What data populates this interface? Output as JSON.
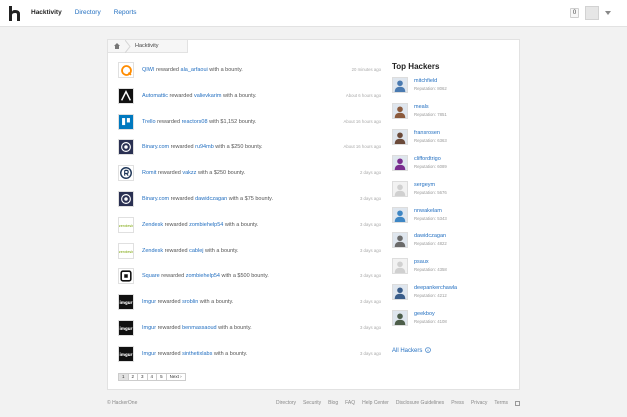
{
  "nav": {
    "items": [
      "Hacktivity",
      "Directory",
      "Reports"
    ],
    "active": 0
  },
  "user": {
    "notifications": "0"
  },
  "breadcrumb": {
    "label": "Hacktivity"
  },
  "feed": [
    {
      "org": "QIWI",
      "verb": "rewarded",
      "user": "ala_arfaoui",
      "rest": "with a bounty.",
      "time": "20 minutes ago",
      "icon": "qiwi-logo-icon",
      "color": "#ff8c00"
    },
    {
      "org": "Automattic",
      "verb": "rewarded",
      "user": "valievkarim",
      "rest": "with a bounty.",
      "time": "About 6 hours ago",
      "icon": "automattic-logo-icon",
      "color": "#111111"
    },
    {
      "org": "Trello",
      "verb": "rewarded",
      "user": "reactors08",
      "rest": "with $1,152 bounty.",
      "time": "About 16 hours ago",
      "icon": "trello-logo-icon",
      "color": "#0079bf"
    },
    {
      "org": "Binary.com",
      "verb": "rewarded",
      "user": "ru94mb",
      "rest": "with a $250 bounty.",
      "time": "About 16 hours ago",
      "icon": "binary-logo-icon",
      "color": "#2a3052"
    },
    {
      "org": "Romit",
      "verb": "rewarded",
      "user": "vakzz",
      "rest": "with a $250 bounty.",
      "time": "2 days ago",
      "icon": "romit-logo-icon",
      "color": "#1d3557"
    },
    {
      "org": "Binary.com",
      "verb": "rewarded",
      "user": "dawidczagan",
      "rest": "with a $75 bounty.",
      "time": "3 days ago",
      "icon": "binary-logo-icon",
      "color": "#2a3052"
    },
    {
      "org": "Zendesk",
      "verb": "rewarded",
      "user": "zombiehelp54",
      "rest": "with a bounty.",
      "time": "3 days ago",
      "icon": "zendesk-logo-icon",
      "color": "#78a300"
    },
    {
      "org": "Zendesk",
      "verb": "rewarded",
      "user": "cablej",
      "rest": "with a bounty.",
      "time": "3 days ago",
      "icon": "zendesk-logo-icon",
      "color": "#78a300"
    },
    {
      "org": "Square",
      "verb": "rewarded",
      "user": "zombiehelp54",
      "rest": "with a $500 bounty.",
      "time": "3 days ago",
      "icon": "square-logo-icon",
      "color": "#111111"
    },
    {
      "org": "Imgur",
      "verb": "rewarded",
      "user": "sroblin",
      "rest": "with a bounty.",
      "time": "3 days ago",
      "icon": "imgur-logo-icon",
      "color": "#111111"
    },
    {
      "org": "Imgur",
      "verb": "rewarded",
      "user": "benmassaoud",
      "rest": "with a bounty.",
      "time": "3 days ago",
      "icon": "imgur-logo-icon",
      "color": "#111111"
    },
    {
      "org": "Imgur",
      "verb": "rewarded",
      "user": "sinthetixlabs",
      "rest": "with a bounty.",
      "time": "3 days ago",
      "icon": "imgur-logo-icon",
      "color": "#111111"
    }
  ],
  "pagination": {
    "pages": [
      "1",
      "2",
      "3",
      "4",
      "5"
    ],
    "next": "Next ›",
    "current": 0
  },
  "sidebar": {
    "title": "Top Hackers",
    "reputation_label": "Reputation:",
    "hackers": [
      {
        "name": "mitchfield",
        "rep": "8062",
        "color": "#4a7ab0"
      },
      {
        "name": "meals",
        "rep": "7851",
        "color": "#8b5a3c"
      },
      {
        "name": "fransrosen",
        "rep": "6363",
        "color": "#6b4a3a"
      },
      {
        "name": "cliffordtrigo",
        "rep": "6089",
        "color": "#7a2d8f"
      },
      {
        "name": "sergeym",
        "rep": "5676",
        "color": "#e0e0e0"
      },
      {
        "name": "nnwakelam",
        "rep": "5343",
        "color": "#3e86c4"
      },
      {
        "name": "dawidczagan",
        "rep": "4822",
        "color": "#6a6a6a"
      },
      {
        "name": "psaux",
        "rep": "4358",
        "color": "#e0e0e0"
      },
      {
        "name": "deepankerchawla",
        "rep": "4212",
        "color": "#3a5d8a"
      },
      {
        "name": "geekboy",
        "rep": "4108",
        "color": "#4d5e4a"
      }
    ],
    "all_label": "All Hackers"
  },
  "footer": {
    "copyright": "© HackerOne",
    "links": [
      "Directory",
      "Security",
      "Blog",
      "FAQ",
      "Help Center",
      "Disclosure Guidelines",
      "Press",
      "Privacy",
      "Terms"
    ]
  }
}
